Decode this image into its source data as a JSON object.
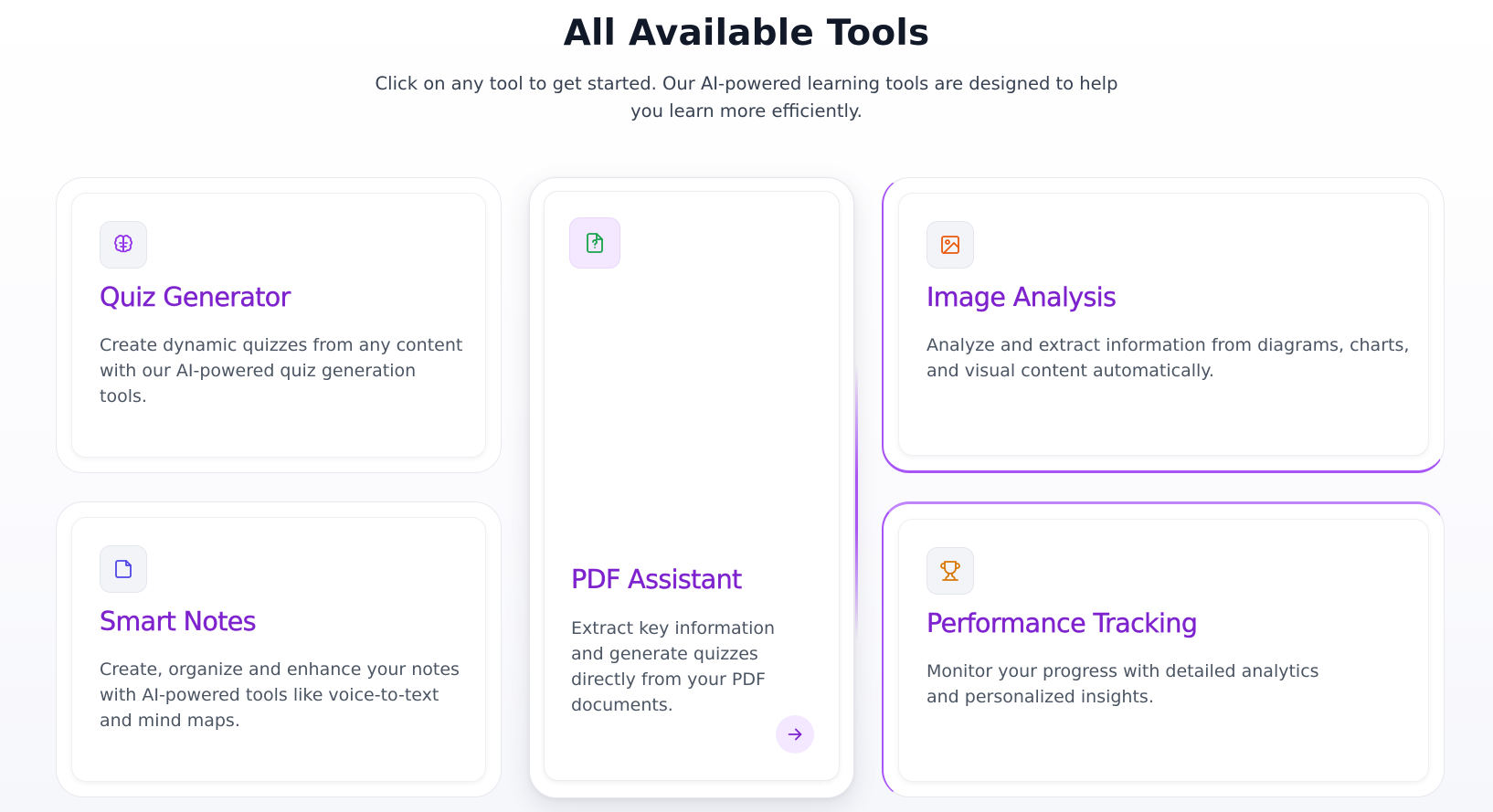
{
  "header": {
    "title": "All Available Tools",
    "subtitle": "Click on any tool to get started. Our AI-powered learning tools are designed to help you learn more efficiently."
  },
  "tools": [
    {
      "title": "Quiz Generator",
      "description": "Create dynamic quizzes from any content with our AI-powered quiz generation tools.",
      "icon": "brain-icon",
      "icon_color": "#9333ea"
    },
    {
      "title": "PDF Assistant",
      "description": "Extract key information and generate quizzes directly from your PDF documents.",
      "icon": "file-question-icon",
      "icon_color": "#16a34a",
      "action_icon": "arrow-right-icon"
    },
    {
      "title": "Image Analysis",
      "description": "Analyze and extract information from diagrams, charts, and visual content automatically.",
      "icon": "image-icon",
      "icon_color": "#ea580c"
    },
    {
      "title": "Smart Notes",
      "description": "Create, organize and enhance your notes with AI-powered tools like voice-to-text and mind maps.",
      "icon": "sticky-note-icon",
      "icon_color": "#4f46e5"
    },
    {
      "title": "Performance Tracking",
      "description": "Monitor your progress with detailed analytics and personalized insights.",
      "icon": "trophy-icon",
      "icon_color": "#d97706"
    }
  ],
  "colors": {
    "accent": "#7e22ce",
    "accent_light": "#f3e8ff",
    "border": "#e8e8ef"
  }
}
